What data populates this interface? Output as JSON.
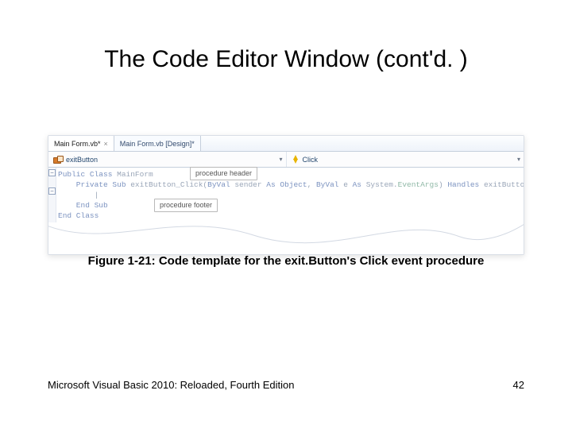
{
  "slide": {
    "title": "The Code Editor Window (cont'd. )",
    "caption": "Figure 1-21: Code template for the exit.Button's Click event procedure",
    "footer_left": "Microsoft Visual Basic 2010: Reloaded, Fourth Edition",
    "page_number": "42"
  },
  "tabs": [
    {
      "label": "Main Form.vb*",
      "active": true
    },
    {
      "label": "Main Form.vb [Design]*",
      "active": false
    }
  ],
  "selectors": {
    "object": "exitButton",
    "event": "Click"
  },
  "callouts": {
    "header": "procedure header",
    "footer": "procedure footer"
  },
  "code": {
    "line1_a": "Public Class",
    "line1_b": " MainForm",
    "line2_a": "    Private Sub",
    "line2_b": " exitButton_Click(",
    "line2_c": "ByVal",
    "line2_d": " sender ",
    "line2_e": "As Object",
    "line2_f": ", ",
    "line2_g": "ByVal",
    "line2_h": " e ",
    "line2_i": "As",
    "line2_j": " System.",
    "line2_k": "EventArgs",
    "line2_l": ") ",
    "line2_m": "Handles",
    "line2_n": " exitButton.Click",
    "line3": "        |",
    "line4": "    End Sub",
    "line5": "End Class"
  }
}
